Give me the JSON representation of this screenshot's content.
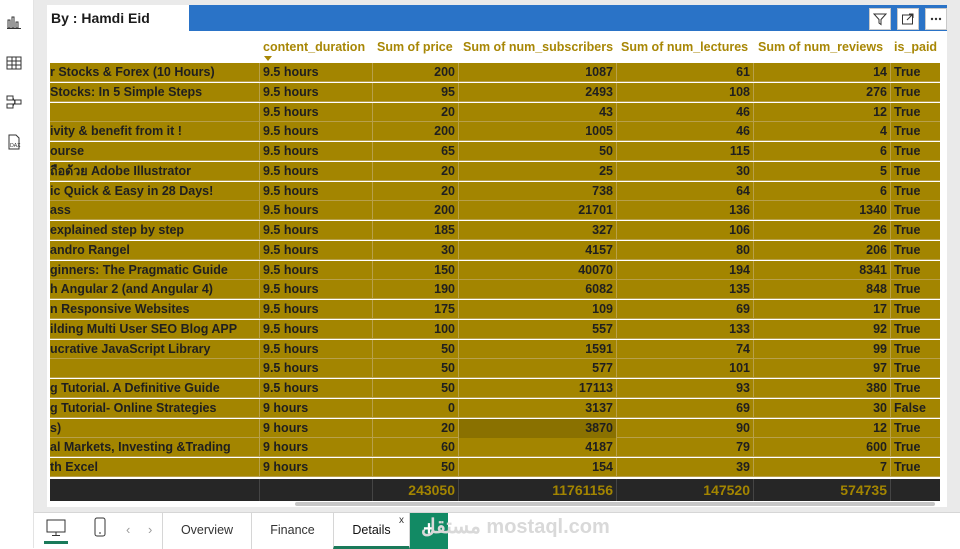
{
  "visual": {
    "title": "By : Hamdi Eid"
  },
  "icons": {
    "rail": [
      "report-view-icon",
      "table-view-icon",
      "model-view-icon",
      "dax-query-icon"
    ],
    "header": [
      "filter-icon",
      "focus-mode-icon",
      "more-options-icon"
    ]
  },
  "table": {
    "columns": [
      "",
      "content_duration",
      "Sum of price",
      "Sum of num_subscribers",
      "Sum of num_lectures",
      "Sum of num_reviews",
      "is_paid"
    ],
    "rows": [
      [
        "r Stocks & Forex (10 Hours)",
        "9.5 hours",
        "200",
        "1087",
        "61",
        "14",
        "True"
      ],
      [
        " Stocks: In 5 Simple Steps",
        "9.5 hours",
        "95",
        "2493",
        "108",
        "276",
        "True"
      ],
      [
        "",
        "9.5 hours",
        "20",
        "43",
        "46",
        "12",
        "True"
      ],
      [
        "ivity & benefit from it !",
        "9.5 hours",
        "200",
        "1005",
        "46",
        "4",
        "True"
      ],
      [
        "ourse",
        "9.5 hours",
        "65",
        "50",
        "115",
        "6",
        "True"
      ],
      [
        "ถือด้วย Adobe Illustrator",
        "9.5 hours",
        "20",
        "25",
        "30",
        "5",
        "True"
      ],
      [
        "ic Quick & Easy in 28 Days!",
        "9.5 hours",
        "20",
        "738",
        "64",
        "6",
        "True"
      ],
      [
        "ass",
        "9.5 hours",
        "200",
        "21701",
        "136",
        "1340",
        "True"
      ],
      [
        "explained step by step",
        "9.5 hours",
        "185",
        "327",
        "106",
        "26",
        "True"
      ],
      [
        "andro Rangel",
        "9.5 hours",
        "30",
        "4157",
        "80",
        "206",
        "True"
      ],
      [
        "ginners: The Pragmatic Guide",
        "9.5 hours",
        "150",
        "40070",
        "194",
        "8341",
        "True"
      ],
      [
        "h Angular 2 (and Angular 4)",
        "9.5 hours",
        "190",
        "6082",
        "135",
        "848",
        "True"
      ],
      [
        "n Responsive Websites",
        "9.5 hours",
        "175",
        "109",
        "69",
        "17",
        "True"
      ],
      [
        "ilding Multi User SEO Blog APP",
        "9.5 hours",
        "100",
        "557",
        "133",
        "92",
        "True"
      ],
      [
        "ucrative JavaScript Library",
        "9.5 hours",
        "50",
        "1591",
        "74",
        "99",
        "True"
      ],
      [
        "",
        "9.5 hours",
        "50",
        "577",
        "101",
        "97",
        "True"
      ],
      [
        "g Tutorial. A Definitive Guide",
        "9.5 hours",
        "50",
        "17113",
        "93",
        "380",
        "True"
      ],
      [
        "g Tutorial- Online Strategies",
        "9 hours",
        "0",
        "3137",
        "69",
        "30",
        "False"
      ],
      [
        "s)",
        "9 hours",
        "20",
        "3870",
        "90",
        "12",
        "True"
      ],
      [
        "al Markets, Investing &Trading",
        "9 hours",
        "60",
        "4187",
        "79",
        "600",
        "True"
      ],
      [
        "th Excel",
        "9 hours",
        "50",
        "154",
        "39",
        "7",
        "True"
      ]
    ],
    "totals": [
      "",
      "",
      "243050",
      "11761156",
      "147520",
      "574735",
      ""
    ]
  },
  "tabs": [
    {
      "label": "Overview",
      "active": false
    },
    {
      "label": "Finance",
      "active": false
    },
    {
      "label": "Details",
      "active": true
    }
  ],
  "tab_close": "x",
  "add_tab": "+",
  "watermark": "مستقل mostaql.com",
  "colors": {
    "row_bg": "#a38500",
    "header_text": "#a88706",
    "totals_bg": "#262626",
    "accent": "#1a7a5a",
    "visual_header": "#2a73c7"
  }
}
